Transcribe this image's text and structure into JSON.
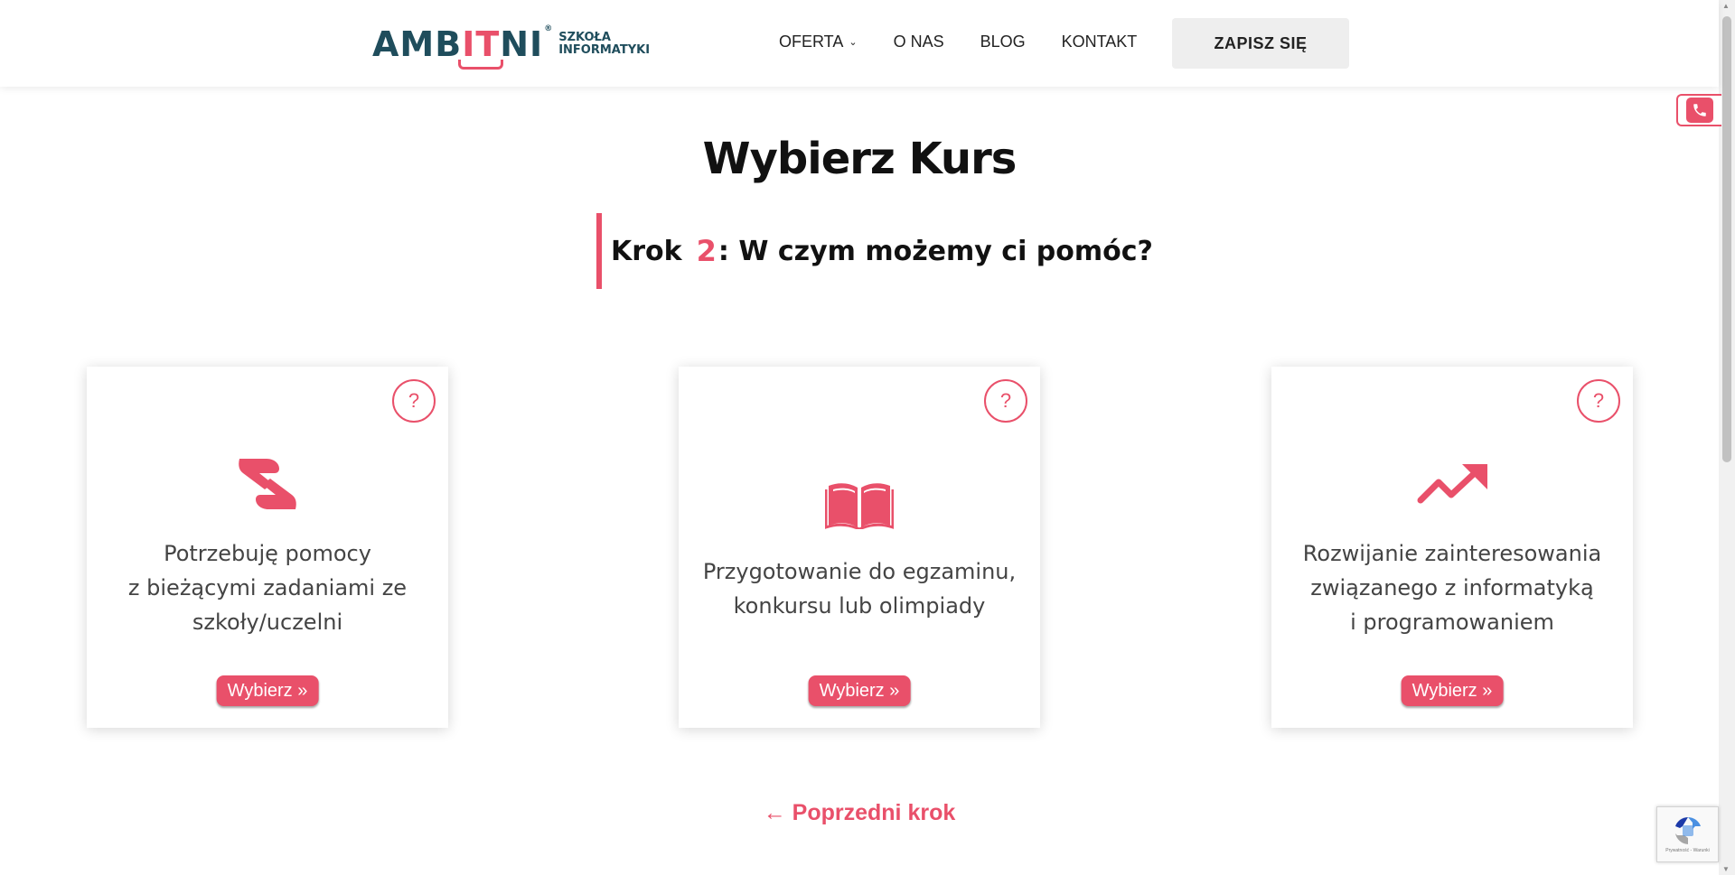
{
  "header": {
    "logo": {
      "main_pre": "AMB",
      "main_it": "IT",
      "main_post": "NI",
      "reg": "®",
      "sub_line1": "SZKOŁA",
      "sub_line2": "INFORMATYKI"
    },
    "nav": [
      {
        "label": "OFERTA",
        "has_dropdown": true
      },
      {
        "label": "O NAS",
        "has_dropdown": false
      },
      {
        "label": "BLOG",
        "has_dropdown": false
      },
      {
        "label": "KONTAKT",
        "has_dropdown": false
      }
    ],
    "cta_label": "ZAPISZ SIĘ"
  },
  "main": {
    "title": "Wybierz Kurs",
    "step": {
      "prefix": "Krok",
      "number": "2",
      "question": ": W czym możemy ci pomóc?"
    },
    "cards": [
      {
        "icon": "helping-hands-icon",
        "help": "?",
        "line1": "Potrzebuję pomocy",
        "line2": "z bieżącymi zadaniami ze",
        "line3": "szkoły/uczelni",
        "button": "Wybierz »"
      },
      {
        "icon": "open-book-icon",
        "help": "?",
        "line1": "Przygotowanie do egzaminu,",
        "line2": "konkursu lub olimpiady",
        "button": "Wybierz »"
      },
      {
        "icon": "trending-up-icon",
        "help": "?",
        "line1": "Rozwijanie zainteresowania",
        "line2": "związanego z informatyką",
        "line3": "i programowaniem",
        "button": "Wybierz »"
      }
    ],
    "prev_link": "← Poprzedni krok"
  },
  "recaptcha": {
    "text": "Prywatność - Warunki"
  },
  "colors": {
    "accent": "#e9506a",
    "brand_dark": "#1f4d5c"
  }
}
